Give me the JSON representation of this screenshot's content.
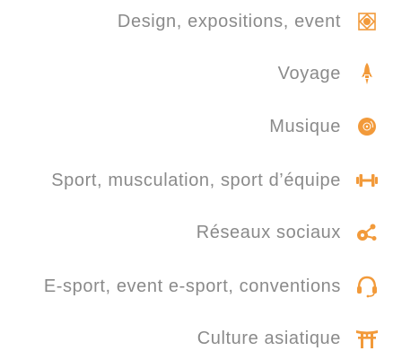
{
  "accent_color": "#f29a3a",
  "items": [
    {
      "label": "Design, expositions, event",
      "icon": "diamond-target-icon"
    },
    {
      "label": "Voyage",
      "icon": "rocket-icon"
    },
    {
      "label": "Musique",
      "icon": "vinyl-record-icon"
    },
    {
      "label": "Sport, musculation, sport d’équipe",
      "icon": "dumbbell-icon"
    },
    {
      "label": "Réseaux sociaux",
      "icon": "share-icon"
    },
    {
      "label": "E-sport, event e-sport, conventions",
      "icon": "headset-icon"
    },
    {
      "label": "Culture asiatique",
      "icon": "torii-gate-icon"
    }
  ]
}
